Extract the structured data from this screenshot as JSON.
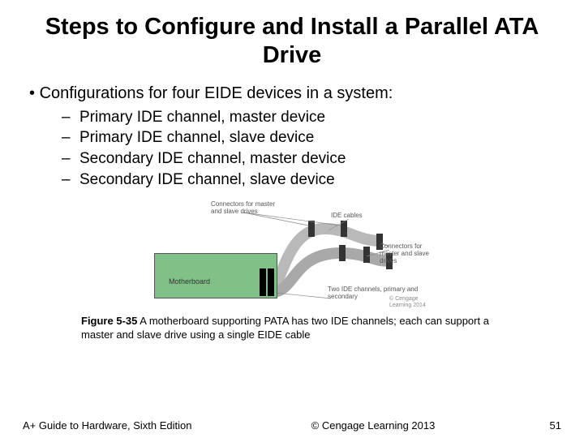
{
  "title": "Steps to Configure and Install a Parallel ATA Drive",
  "bullet": "Configurations for four EIDE devices in a system:",
  "subitems": [
    "Primary IDE channel, master device",
    "Primary IDE channel, slave device",
    "Secondary IDE channel, master device",
    "Secondary IDE channel, slave device"
  ],
  "figure": {
    "motherboard_label": "Motherboard",
    "label_topleft": "Connectors for master and slave drives",
    "label_topright": "IDE cables",
    "label_right": "Connectors for master and slave drives",
    "label_bottom": "Two IDE channels, primary and secondary",
    "label_copy": "© Cengage Learning 2014"
  },
  "caption_bold": "Figure 5-35",
  "caption_rest": " A motherboard supporting PATA has two IDE channels; each can support a master and slave drive using a single EIDE cable",
  "footer": {
    "book": "A+ Guide to Hardware, Sixth Edition",
    "copyright": "© Cengage Learning  2013",
    "page": "51"
  }
}
